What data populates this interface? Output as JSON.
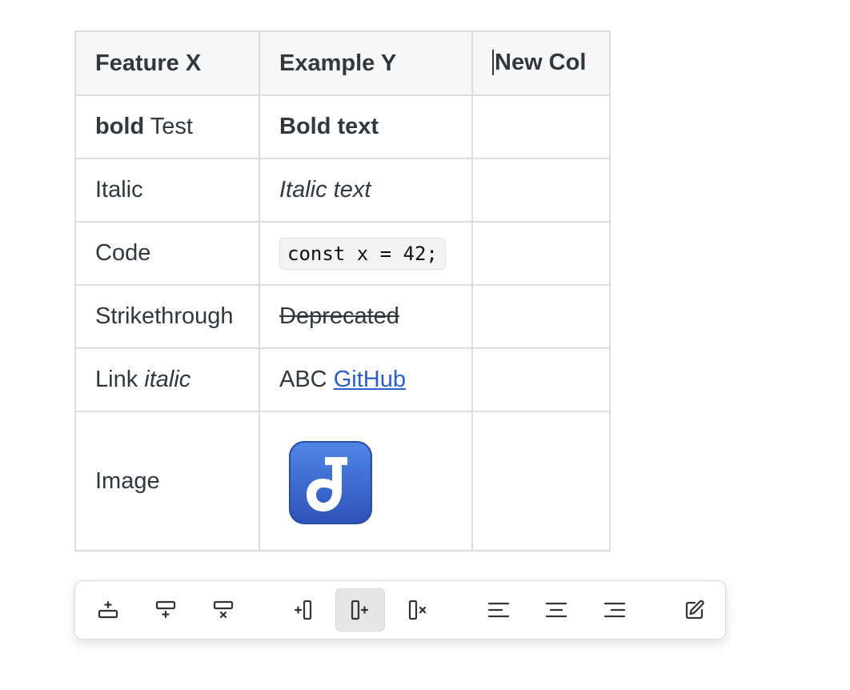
{
  "table": {
    "headers": [
      "Feature X",
      "Example Y",
      "New Col"
    ],
    "rows": [
      {
        "feature_bold": "bold",
        "feature_rest": " Test",
        "example": "Bold text"
      },
      {
        "feature": "Italic",
        "example": "Italic text"
      },
      {
        "feature": "Code",
        "example": "const x = 42;"
      },
      {
        "feature": "Strikethrough",
        "example": "Deprecated"
      },
      {
        "feature": "Link",
        "feature_italic": "italic",
        "example_prefix": "ABC",
        "example_link": "GitHub"
      },
      {
        "feature": "Image",
        "example_icon": "joplin-logo-icon"
      }
    ]
  },
  "toolbar": {
    "buttons": [
      {
        "icon": "insert-row-above-icon",
        "active": false
      },
      {
        "icon": "insert-row-below-icon",
        "active": false
      },
      {
        "icon": "delete-row-icon",
        "active": false
      },
      {
        "icon": "insert-column-left-icon",
        "active": false
      },
      {
        "icon": "insert-column-right-icon",
        "active": true
      },
      {
        "icon": "delete-column-icon",
        "active": false
      },
      {
        "icon": "align-left-icon",
        "active": false
      },
      {
        "icon": "align-center-icon",
        "active": false
      },
      {
        "icon": "align-right-icon",
        "active": false
      },
      {
        "icon": "edit-icon",
        "active": false
      }
    ]
  },
  "colors": {
    "text": "#32373d",
    "link": "#2a5fc9",
    "header_bg": "#f7f7f7",
    "border": "#dcdcdc",
    "logo_blue": "#3f6fd8"
  }
}
